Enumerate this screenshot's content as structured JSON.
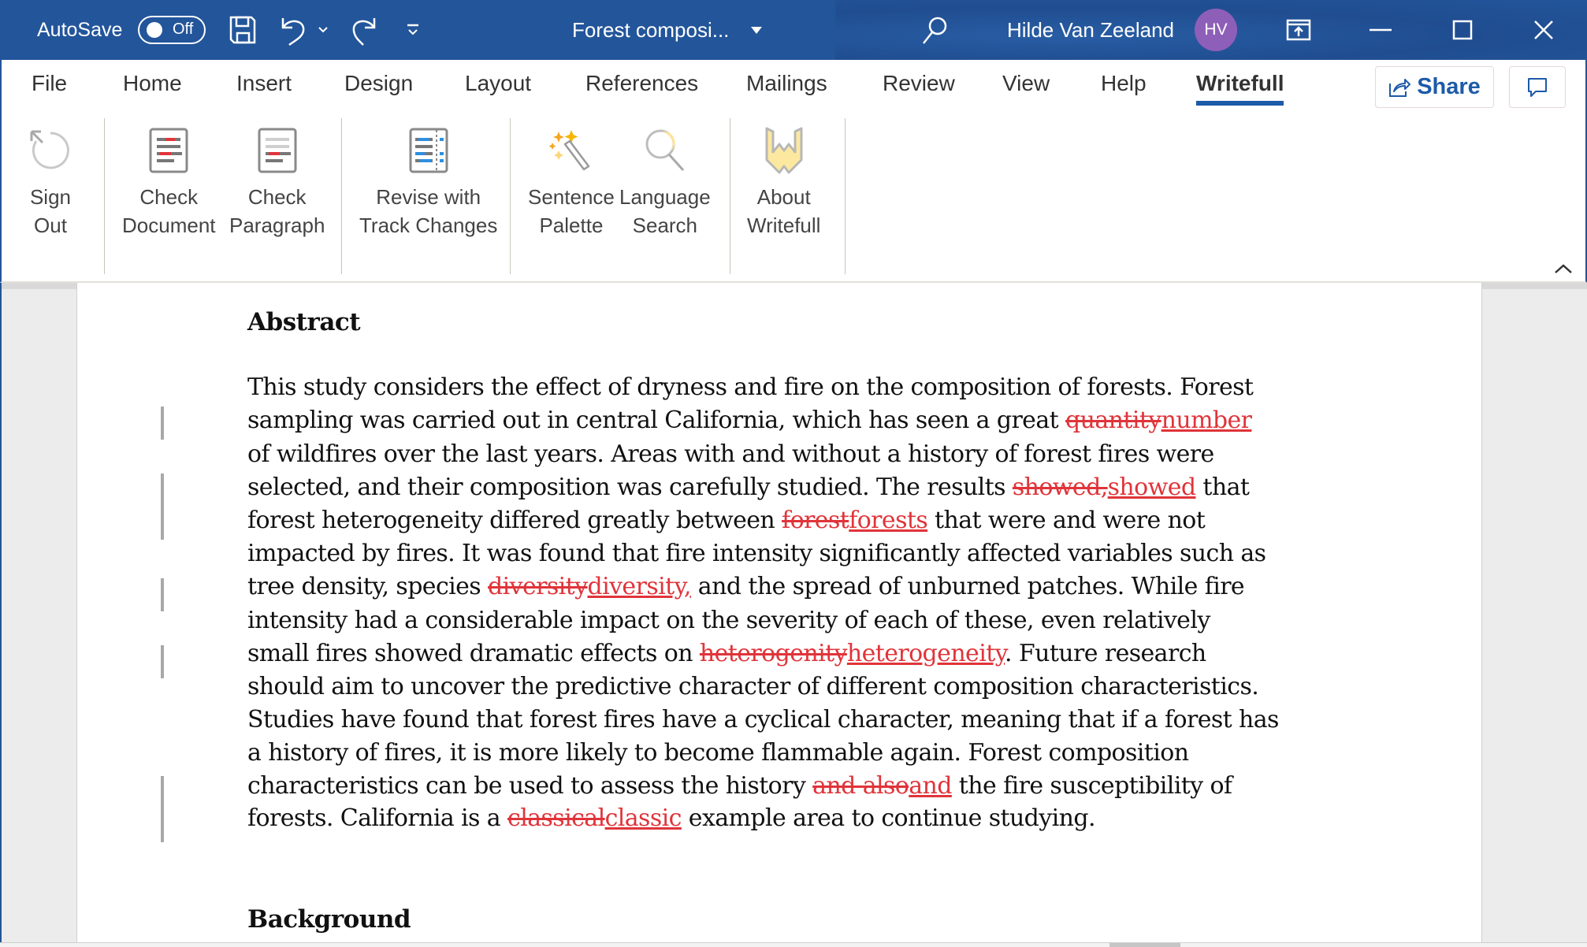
{
  "titlebar": {
    "autosave_label": "AutoSave",
    "autosave_state": "Off",
    "document_title": "Forest composi...",
    "user_name": "Hilde Van Zeeland",
    "user_initials": "HV",
    "icons": [
      "save-icon",
      "undo-icon",
      "undo-dropdown-icon",
      "redo-icon",
      "customize-quick-access-icon",
      "title-dropdown-icon",
      "search-icon",
      "ribbon-display-options-icon",
      "minimize-icon",
      "maximize-icon",
      "close-icon"
    ],
    "accent_color": "#23559a",
    "avatar_color": "#8e5fb8"
  },
  "tabs": [
    {
      "label": "File"
    },
    {
      "label": "Home"
    },
    {
      "label": "Insert"
    },
    {
      "label": "Design"
    },
    {
      "label": "Layout"
    },
    {
      "label": "References"
    },
    {
      "label": "Mailings"
    },
    {
      "label": "Review"
    },
    {
      "label": "View"
    },
    {
      "label": "Help"
    },
    {
      "label": "Writefull",
      "active": true
    }
  ],
  "share_label": "Share",
  "ribbon": {
    "buttons": [
      {
        "line1": "Sign",
        "line2": "Out",
        "icon": "sign-out-icon"
      },
      {
        "line1": "Check",
        "line2": "Document",
        "icon": "check-document-icon"
      },
      {
        "line1": "Check",
        "line2": "Paragraph",
        "icon": "check-paragraph-icon"
      },
      {
        "line1": "Revise with",
        "line2": "Track Changes",
        "icon": "track-changes-icon"
      },
      {
        "line1": "Sentence",
        "line2": "Palette",
        "icon": "magic-wand-icon"
      },
      {
        "line1": "Language",
        "line2": "Search",
        "icon": "magnifier-icon"
      },
      {
        "line1": "About",
        "line2": "Writefull",
        "icon": "writefull-logo-icon"
      }
    ]
  },
  "document": {
    "heading1": "Abstract",
    "heading2": "Background",
    "track_change_color": "#e0343a",
    "lines": [
      [
        {
          "t": "This study considers the effect of dryness and fire on the composition of forests. Forest"
        }
      ],
      [
        {
          "t": "sampling was carried out in central California, which has seen a great "
        },
        {
          "t": "quantity",
          "k": "del"
        },
        {
          "t": "number",
          "k": "ins"
        }
      ],
      [
        {
          "t": "of wildfires over the last years. Areas with and without a history of forest fires were"
        }
      ],
      [
        {
          "t": "selected, and their composition was carefully studied. The results "
        },
        {
          "t": "showed,",
          "k": "del"
        },
        {
          "t": "showed",
          "k": "ins"
        },
        {
          "t": " that"
        }
      ],
      [
        {
          "t": "forest heterogeneity differed greatly between "
        },
        {
          "t": "forest",
          "k": "del"
        },
        {
          "t": "forests",
          "k": "ins"
        },
        {
          "t": " that were and were not"
        }
      ],
      [
        {
          "t": "impacted by fires. It was found that fire intensity significantly affected variables such as"
        }
      ],
      [
        {
          "t": "tree density, species "
        },
        {
          "t": "diversity",
          "k": "del"
        },
        {
          "t": "diversity,",
          "k": "ins"
        },
        {
          "t": " and the spread of unburned patches. While fire"
        }
      ],
      [
        {
          "t": "intensity had a considerable impact on the severity of each of these, even relatively"
        }
      ],
      [
        {
          "t": "small fires showed dramatic effects on "
        },
        {
          "t": "heterogenity",
          "k": "del"
        },
        {
          "t": "heterogeneity",
          "k": "ins"
        },
        {
          "t": ". Future research"
        }
      ],
      [
        {
          "t": "should aim to uncover the predictive character of different composition characteristics."
        }
      ],
      [
        {
          "t": "Studies have found that forest fires have a cyclical character, meaning that if a forest has"
        }
      ],
      [
        {
          "t": "a history of fires, it is more likely to become flammable again. Forest composition"
        }
      ],
      [
        {
          "t": "characteristics can be used to assess the history "
        },
        {
          "t": "and also",
          "k": "del"
        },
        {
          "t": "and",
          "k": "ins"
        },
        {
          "t": " the fire susceptibility of"
        }
      ],
      [
        {
          "t": "forests. California is a "
        },
        {
          "t": "classical",
          "k": "del"
        },
        {
          "t": "classic",
          "k": "ins"
        },
        {
          "t": " example area to continue studying."
        }
      ]
    ]
  }
}
